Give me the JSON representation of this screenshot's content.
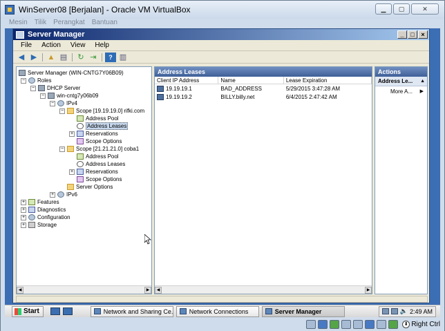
{
  "vbox": {
    "title": "WinServer08 [Berjalan] - Oracle VM VirtualBox",
    "menu": [
      "Mesin",
      "Tilik",
      "Perangkat",
      "Bantuan"
    ],
    "host_key": "Right Ctrl"
  },
  "sm": {
    "title": "Server Manager",
    "menu": [
      "File",
      "Action",
      "View",
      "Help"
    ],
    "tree": [
      {
        "label": "Server Manager (WIN-CNTG7Y06B09)",
        "icon": "server-icon"
      },
      {
        "label": "Roles",
        "icon": "roles-icon"
      },
      {
        "label": "DHCP Server",
        "icon": "dhcp-icon"
      },
      {
        "label": "win-cntg7y06b09",
        "icon": "server-icon"
      },
      {
        "label": "IPv4",
        "icon": "ipv4-icon"
      },
      {
        "label": "Scope [19.19.19.0] rifki.com",
        "icon": "folder-icon"
      },
      {
        "label": "Address Pool",
        "icon": "pool-icon"
      },
      {
        "label": "Address Leases",
        "icon": "lease-icon"
      },
      {
        "label": "Reservations",
        "icon": "reservations-icon"
      },
      {
        "label": "Scope Options",
        "icon": "options-icon"
      },
      {
        "label": "Scope [21.21.21.0] coba1",
        "icon": "folder-icon"
      },
      {
        "label": "Address Pool",
        "icon": "pool-icon"
      },
      {
        "label": "Address Leases",
        "icon": "lease-icon"
      },
      {
        "label": "Reservations",
        "icon": "reservations-icon"
      },
      {
        "label": "Scope Options",
        "icon": "options-icon"
      },
      {
        "label": "Server Options",
        "icon": "options-icon"
      },
      {
        "label": "IPv6",
        "icon": "ipv6-icon"
      },
      {
        "label": "Features",
        "icon": "features-icon"
      },
      {
        "label": "Diagnostics",
        "icon": "diagnostics-icon"
      },
      {
        "label": "Configuration",
        "icon": "configuration-icon"
      },
      {
        "label": "Storage",
        "icon": "storage-icon"
      }
    ],
    "list": {
      "header": "Address Leases",
      "columns": [
        "Client IP Address",
        "Name",
        "Lease Expiration"
      ],
      "rows": [
        {
          "ip": "19.19.19.1",
          "name": "BAD_ADDRESS",
          "expiration": "5/29/2015 3:47:28 AM"
        },
        {
          "ip": "19.19.19.2",
          "name": "BILLY.billy.net",
          "expiration": "6/4/2015 2:47:42 AM"
        }
      ]
    },
    "actions": {
      "header": "Actions",
      "sub": "Address Le...",
      "more": "More A..."
    }
  },
  "taskbar": {
    "start": "Start",
    "tasks": [
      "Network and Sharing Ce...",
      "Network Connections",
      "Server Manager"
    ],
    "clock": "2:49 AM"
  }
}
